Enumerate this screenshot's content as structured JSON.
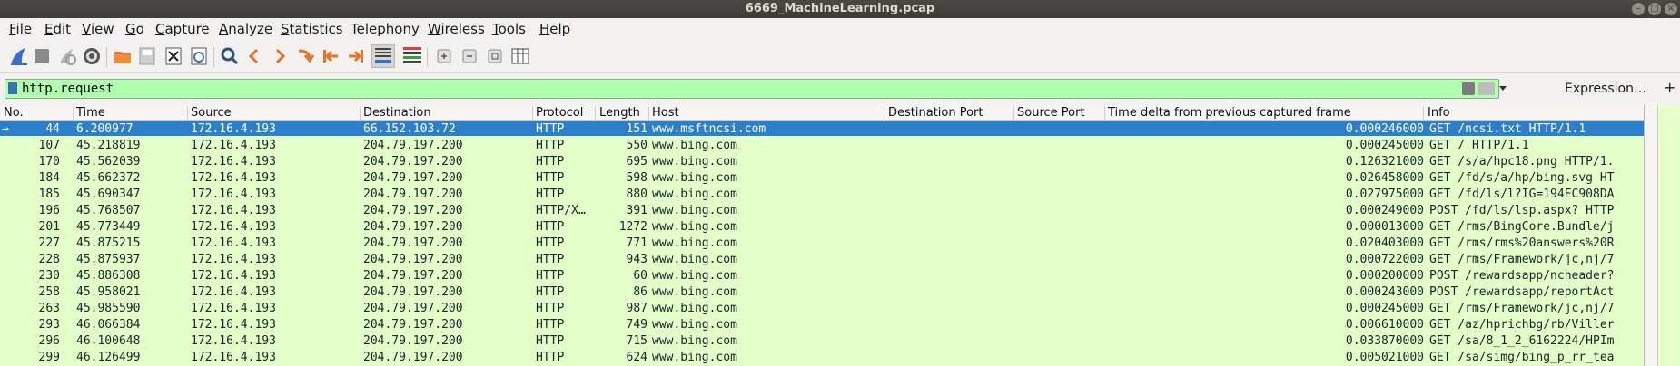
{
  "window": {
    "title": "6669_MachineLearning.pcap"
  },
  "menu": [
    {
      "label": "File",
      "u": "F",
      "rest": "ile"
    },
    {
      "label": "Edit",
      "u": "E",
      "rest": "dit"
    },
    {
      "label": "View",
      "u": "V",
      "rest": "iew"
    },
    {
      "label": "Go",
      "u": "G",
      "rest": "o"
    },
    {
      "label": "Capture",
      "u": "C",
      "rest": "apture"
    },
    {
      "label": "Analyze",
      "u": "A",
      "rest": "nalyze"
    },
    {
      "label": "Statistics",
      "u": "S",
      "rest": "tatistics"
    },
    {
      "label": "Telephony",
      "u": "",
      "rest": "Telephony"
    },
    {
      "label": "Wireless",
      "u": "W",
      "rest": "ireless"
    },
    {
      "label": "Tools",
      "u": "T",
      "rest": "ools"
    },
    {
      "label": "Help",
      "u": "H",
      "rest": "elp"
    }
  ],
  "toolbar_icons": [
    "shark-fin-start-icon",
    "stop-icon",
    "restart-icon",
    "options-gear-icon",
    "open-folder-icon",
    "save-icon",
    "close-file-icon",
    "reload-icon",
    "search-icon",
    "back-icon",
    "forward-icon",
    "goto-packet-icon",
    "first-packet-icon",
    "last-packet-icon",
    "autoscroll-icon",
    "colorize-icon",
    "zoom-in-icon",
    "zoom-out-icon",
    "normal-size-icon",
    "resize-columns-icon"
  ],
  "filter": {
    "value": "http.request",
    "expression_label": "Expression…",
    "add_label": "+"
  },
  "columns": {
    "no": "No.",
    "time": "Time",
    "source": "Source",
    "destination": "Destination",
    "protocol": "Protocol",
    "length": "Length",
    "host": "Host",
    "dest_port": "Destination Port",
    "src_port": "Source Port",
    "delta": "Time delta from previous captured frame",
    "info": "Info"
  },
  "rows": [
    {
      "no": "44",
      "time": "6.200977",
      "source": "172.16.4.193",
      "destination": "66.152.103.72",
      "protocol": "HTTP",
      "length": "151",
      "host": "www.msftncsi.com",
      "dest_port": "",
      "src_port": "",
      "delta": "0.000246000",
      "info": "GET /ncsi.txt HTTP/1.1",
      "selected": true
    },
    {
      "no": "107",
      "time": "45.218819",
      "source": "172.16.4.193",
      "destination": "204.79.197.200",
      "protocol": "HTTP",
      "length": "550",
      "host": "www.bing.com",
      "dest_port": "",
      "src_port": "",
      "delta": "0.000245000",
      "info": "GET / HTTP/1.1"
    },
    {
      "no": "170",
      "time": "45.562039",
      "source": "172.16.4.193",
      "destination": "204.79.197.200",
      "protocol": "HTTP",
      "length": "695",
      "host": "www.bing.com",
      "dest_port": "",
      "src_port": "",
      "delta": "0.126321000",
      "info": "GET /s/a/hpc18.png HTTP/1."
    },
    {
      "no": "184",
      "time": "45.662372",
      "source": "172.16.4.193",
      "destination": "204.79.197.200",
      "protocol": "HTTP",
      "length": "598",
      "host": "www.bing.com",
      "dest_port": "",
      "src_port": "",
      "delta": "0.026458000",
      "info": "GET /fd/s/a/hp/bing.svg HT"
    },
    {
      "no": "185",
      "time": "45.690347",
      "source": "172.16.4.193",
      "destination": "204.79.197.200",
      "protocol": "HTTP",
      "length": "880",
      "host": "www.bing.com",
      "dest_port": "",
      "src_port": "",
      "delta": "0.027975000",
      "info": "GET /fd/ls/l?IG=194EC908DA"
    },
    {
      "no": "196",
      "time": "45.768507",
      "source": "172.16.4.193",
      "destination": "204.79.197.200",
      "protocol": "HTTP/X…",
      "length": "391",
      "host": "www.bing.com",
      "dest_port": "",
      "src_port": "",
      "delta": "0.000249000",
      "info": "POST /fd/ls/lsp.aspx? HTTP"
    },
    {
      "no": "201",
      "time": "45.773449",
      "source": "172.16.4.193",
      "destination": "204.79.197.200",
      "protocol": "HTTP",
      "length": "1272",
      "host": "www.bing.com",
      "dest_port": "",
      "src_port": "",
      "delta": "0.000013000",
      "info": "GET /rms/BingCore.Bundle/j"
    },
    {
      "no": "227",
      "time": "45.875215",
      "source": "172.16.4.193",
      "destination": "204.79.197.200",
      "protocol": "HTTP",
      "length": "771",
      "host": "www.bing.com",
      "dest_port": "",
      "src_port": "",
      "delta": "0.020403000",
      "info": "GET /rms/rms%20answers%20R"
    },
    {
      "no": "228",
      "time": "45.875937",
      "source": "172.16.4.193",
      "destination": "204.79.197.200",
      "protocol": "HTTP",
      "length": "943",
      "host": "www.bing.com",
      "dest_port": "",
      "src_port": "",
      "delta": "0.000722000",
      "info": "GET /rms/Framework/jc,nj/7"
    },
    {
      "no": "230",
      "time": "45.886308",
      "source": "172.16.4.193",
      "destination": "204.79.197.200",
      "protocol": "HTTP",
      "length": "60",
      "host": "www.bing.com",
      "dest_port": "",
      "src_port": "",
      "delta": "0.000200000",
      "info": "POST /rewardsapp/ncheader?"
    },
    {
      "no": "258",
      "time": "45.958021",
      "source": "172.16.4.193",
      "destination": "204.79.197.200",
      "protocol": "HTTP",
      "length": "86",
      "host": "www.bing.com",
      "dest_port": "",
      "src_port": "",
      "delta": "0.000243000",
      "info": "POST /rewardsapp/reportAct"
    },
    {
      "no": "263",
      "time": "45.985590",
      "source": "172.16.4.193",
      "destination": "204.79.197.200",
      "protocol": "HTTP",
      "length": "987",
      "host": "www.bing.com",
      "dest_port": "",
      "src_port": "",
      "delta": "0.000245000",
      "info": "GET /rms/Framework/jc,nj/7"
    },
    {
      "no": "293",
      "time": "46.066384",
      "source": "172.16.4.193",
      "destination": "204.79.197.200",
      "protocol": "HTTP",
      "length": "749",
      "host": "www.bing.com",
      "dest_port": "",
      "src_port": "",
      "delta": "0.006610000",
      "info": "GET /az/hprichbg/rb/Viller"
    },
    {
      "no": "296",
      "time": "46.100648",
      "source": "172.16.4.193",
      "destination": "204.79.197.200",
      "protocol": "HTTP",
      "length": "715",
      "host": "www.bing.com",
      "dest_port": "",
      "src_port": "",
      "delta": "0.033870000",
      "info": "GET /sa/8_1_2_6162224/HPIm"
    },
    {
      "no": "299",
      "time": "46.126499",
      "source": "172.16.4.193",
      "destination": "204.79.197.200",
      "protocol": "HTTP",
      "length": "624",
      "host": "www.bing.com",
      "dest_port": "",
      "src_port": "",
      "delta": "0.005021000",
      "info": "GET /sa/simg/bing_p_rr_tea"
    }
  ]
}
